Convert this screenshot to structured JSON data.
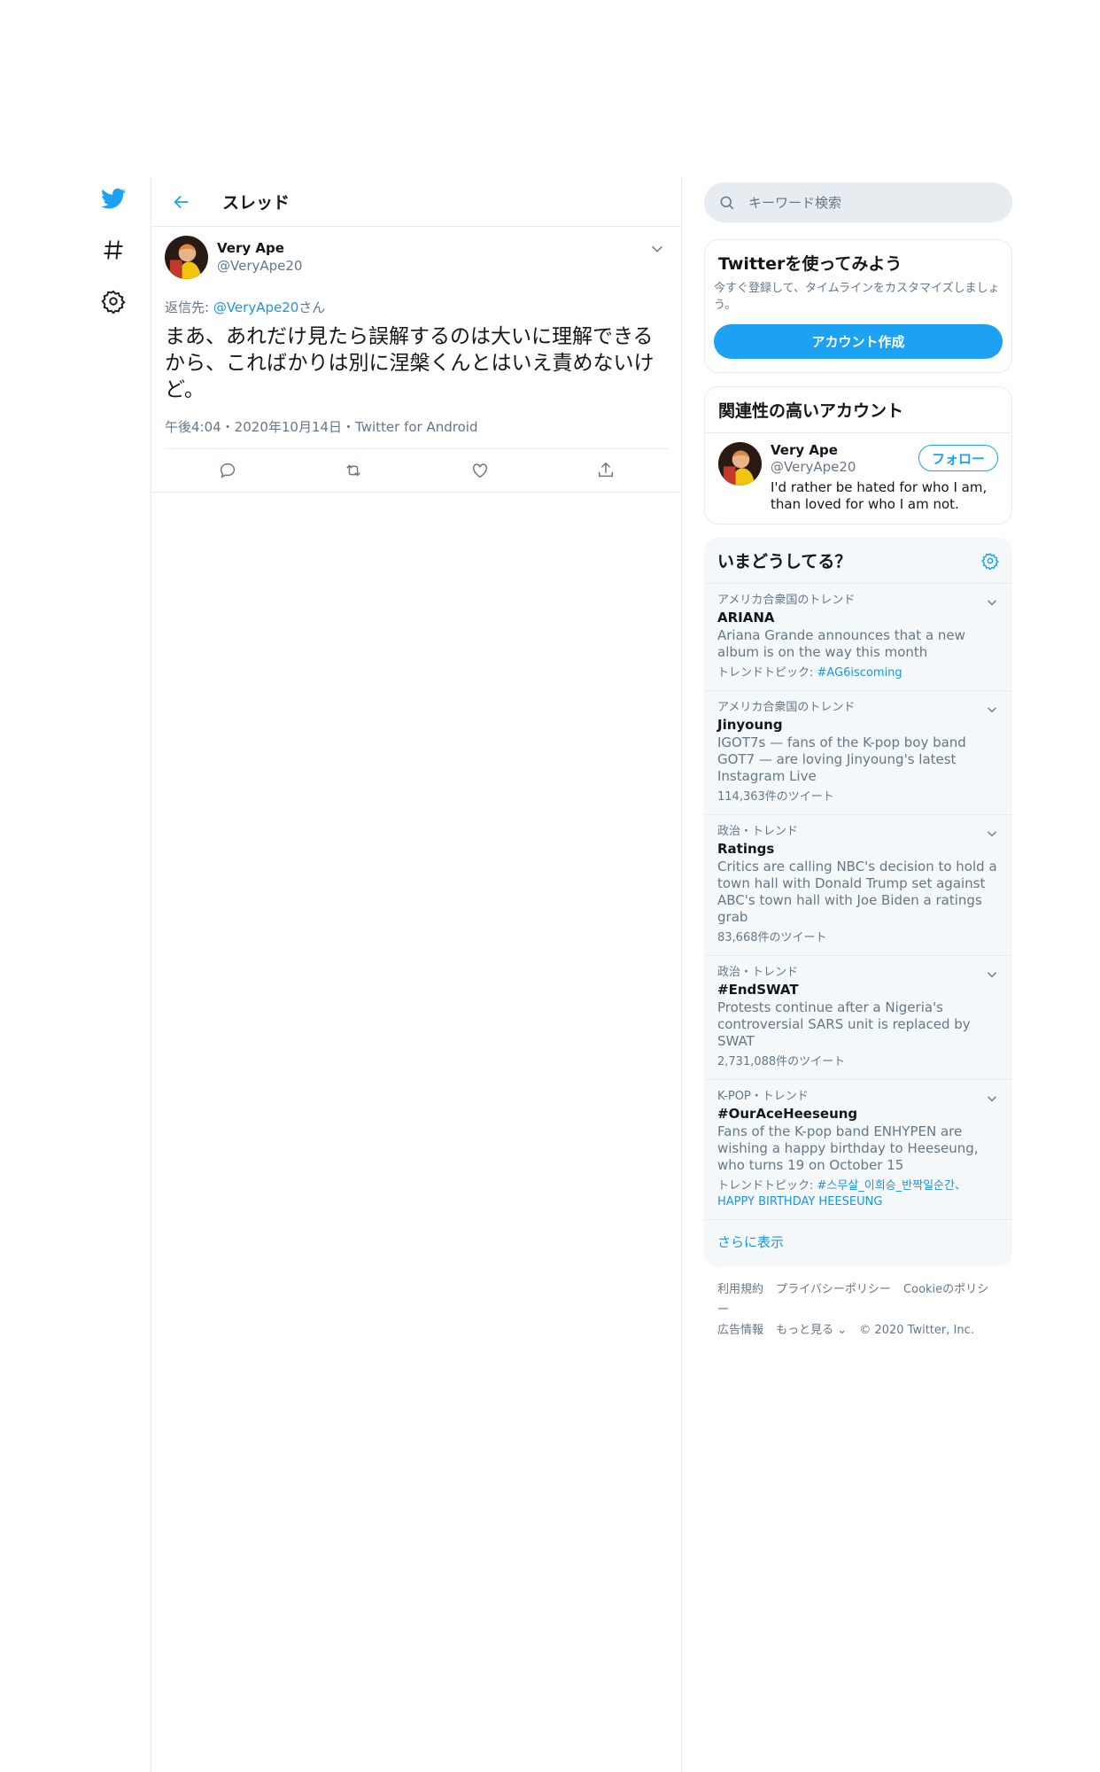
{
  "nav": {
    "icons": [
      "twitter-logo-icon",
      "hashtag-icon",
      "gear-icon"
    ]
  },
  "main": {
    "header_title": "スレッド",
    "tweet": {
      "author_name": "Very Ape",
      "author_handle": "@VeryApe20",
      "reply_prefix": "返信先: ",
      "reply_handle": "@VeryApe20",
      "reply_suffix": "さん",
      "text": "まあ、あれだけ見たら誤解するのは大いに理解できるから、こればかりは別に涅槃くんとはいえ責めないけど。",
      "meta": "午後4:04・2020年10月14日・Twitter for Android"
    }
  },
  "sidebar": {
    "search_placeholder": "キーワード検索",
    "signup": {
      "title": "Twitterを使ってみよう",
      "desc": "今すぐ登録して、タイムラインをカスタマイズしましょう。",
      "button": "アカウント作成"
    },
    "related": {
      "title": "関連性の高いアカウント",
      "name": "Very Ape",
      "handle": "@VeryApe20",
      "bio": "I'd rather be hated for who I am, than loved for who I am not.",
      "follow": "フォロー"
    },
    "trends": {
      "title": "いまどうしてる？",
      "items": [
        {
          "context": "アメリカ合衆国のトレンド",
          "name": "ARIANA",
          "desc": "Ariana Grande announces that a new album is on the way this month",
          "count_prefix": "トレンドトピック: ",
          "count_link": "#AG6iscoming"
        },
        {
          "context": "アメリカ合衆国のトレンド",
          "name": "Jinyoung",
          "desc": "IGOT7s — fans of the K-pop boy band GOT7 — are loving Jinyoung's latest Instagram Live",
          "count_prefix": "114,363件のツイート",
          "count_link": ""
        },
        {
          "context": "政治・トレンド",
          "name": "Ratings",
          "desc": "Critics are calling NBC's decision to hold a town hall with Donald Trump set against ABC's town hall with Joe Biden a ratings grab",
          "count_prefix": "83,668件のツイート",
          "count_link": ""
        },
        {
          "context": "政治・トレンド",
          "name": "#EndSWAT",
          "desc": "Protests continue after a Nigeria's controversial SARS unit is replaced by SWAT",
          "count_prefix": "2,731,088件のツイート",
          "count_link": ""
        },
        {
          "context": "K-POP・トレンド",
          "name": "#OurAceHeeseung",
          "desc": "Fans of the K-pop band ENHYPEN are wishing a happy birthday to Heeseung, who turns 19 on October 15",
          "count_prefix": "トレンドトピック: ",
          "count_link": "#스무살_이희승_반짝일순간、HAPPY BIRTHDAY HEESEUNG"
        }
      ],
      "show_more": "さらに表示"
    },
    "footer": {
      "line1": [
        "利用規約",
        "プライバシーポリシー",
        "Cookieのポリシー"
      ],
      "line2": [
        "広告情報",
        "もっと見る ⌄",
        "© 2020 Twitter, Inc."
      ]
    }
  },
  "colors": {
    "accent": "#1da1f2",
    "link": "#1b95e0",
    "muted": "#657786",
    "border": "#e6ecf0"
  }
}
